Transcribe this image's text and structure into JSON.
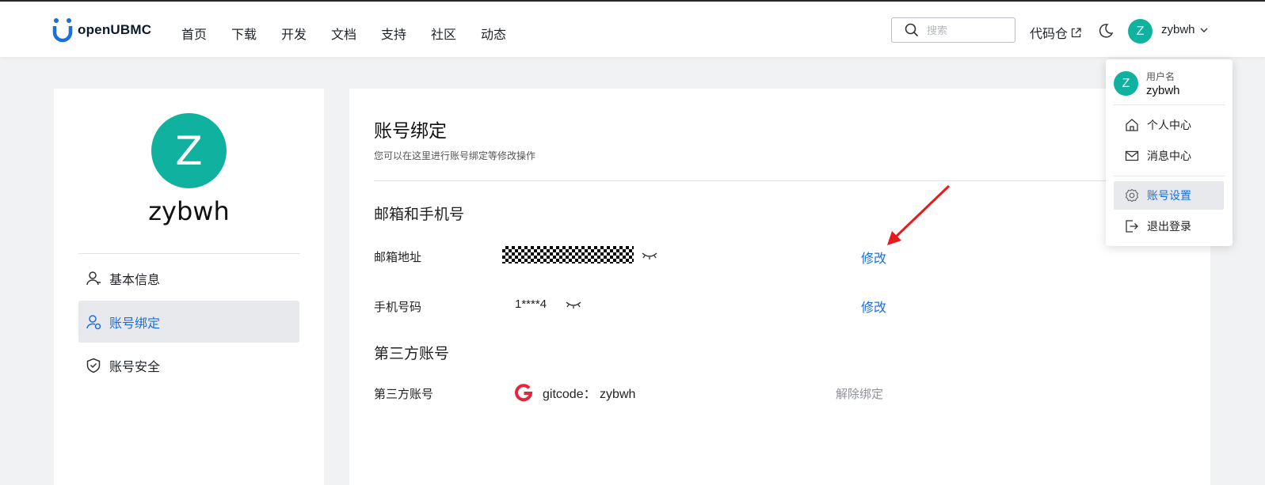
{
  "header": {
    "logo_text": "openUBMC",
    "nav": [
      "首页",
      "下载",
      "开发",
      "文档",
      "支持",
      "社区",
      "动态"
    ],
    "search_placeholder": "搜索",
    "code_repo": "代码仓",
    "avatar_letter": "Z",
    "user_name": "zybwh"
  },
  "sidebar": {
    "avatar_letter": "Z",
    "user_name": "zybwh",
    "items": [
      {
        "label": "基本信息",
        "icon": "user-icon"
      },
      {
        "label": "账号绑定",
        "icon": "user-link-icon",
        "active": true
      },
      {
        "label": "账号安全",
        "icon": "shield-check-icon"
      }
    ]
  },
  "main": {
    "title": "账号绑定",
    "subtitle": "您可以在这里进行账号绑定等修改操作",
    "section_contact": "邮箱和手机号",
    "email_label": "邮箱地址",
    "email_edit": "修改",
    "phone_label": "手机号码",
    "phone_value": "1****4",
    "phone_edit": "修改",
    "section_third": "第三方账号",
    "third_label": "第三方账号",
    "third_account": "gitcode： zybwh",
    "third_unbind": "解除绑定"
  },
  "dropdown": {
    "avatar_letter": "Z",
    "username_label": "用户名",
    "username": "zybwh",
    "items": [
      {
        "label": "个人中心",
        "icon": "home-icon"
      },
      {
        "label": "消息中心",
        "icon": "mail-icon"
      },
      {
        "label": "账号设置",
        "icon": "gear-icon",
        "active": true
      },
      {
        "label": "退出登录",
        "icon": "logout-icon"
      }
    ]
  },
  "colors": {
    "accent": "#1b6fdc",
    "avatar": "#11b19f",
    "annotation_arrow": "#e8191c",
    "gitcode_brand": "#e4253c"
  }
}
